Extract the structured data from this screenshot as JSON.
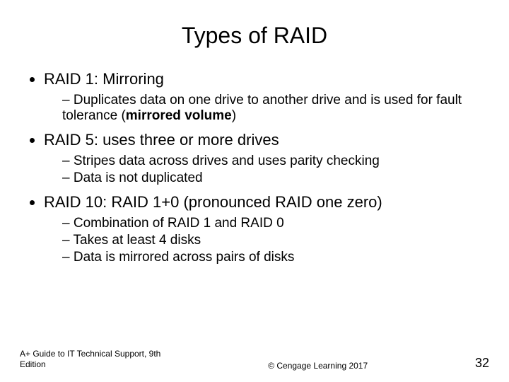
{
  "title": "Types of RAID",
  "bullets": [
    {
      "heading": "RAID 1: Mirroring",
      "sub": [
        "Duplicates data on one drive to another drive and is used for fault tolerance (mirrored volume)"
      ]
    },
    {
      "heading": "RAID 5: uses three or more drives",
      "sub": [
        "Stripes data across drives and uses parity checking",
        "Data is not duplicated"
      ]
    },
    {
      "heading": "RAID 10: RAID 1+0 (pronounced RAID one zero)",
      "sub": [
        "Combination of RAID 1 and RAID 0",
        "Takes at least 4 disks",
        "Data is mirrored across pairs of disks"
      ]
    }
  ],
  "bold_phrase": "mirrored volume",
  "footer": {
    "left_line1": "A+ Guide to IT Technical Support, 9th",
    "left_line2": "Edition",
    "center": "© Cengage Learning  2017",
    "page": "32"
  }
}
